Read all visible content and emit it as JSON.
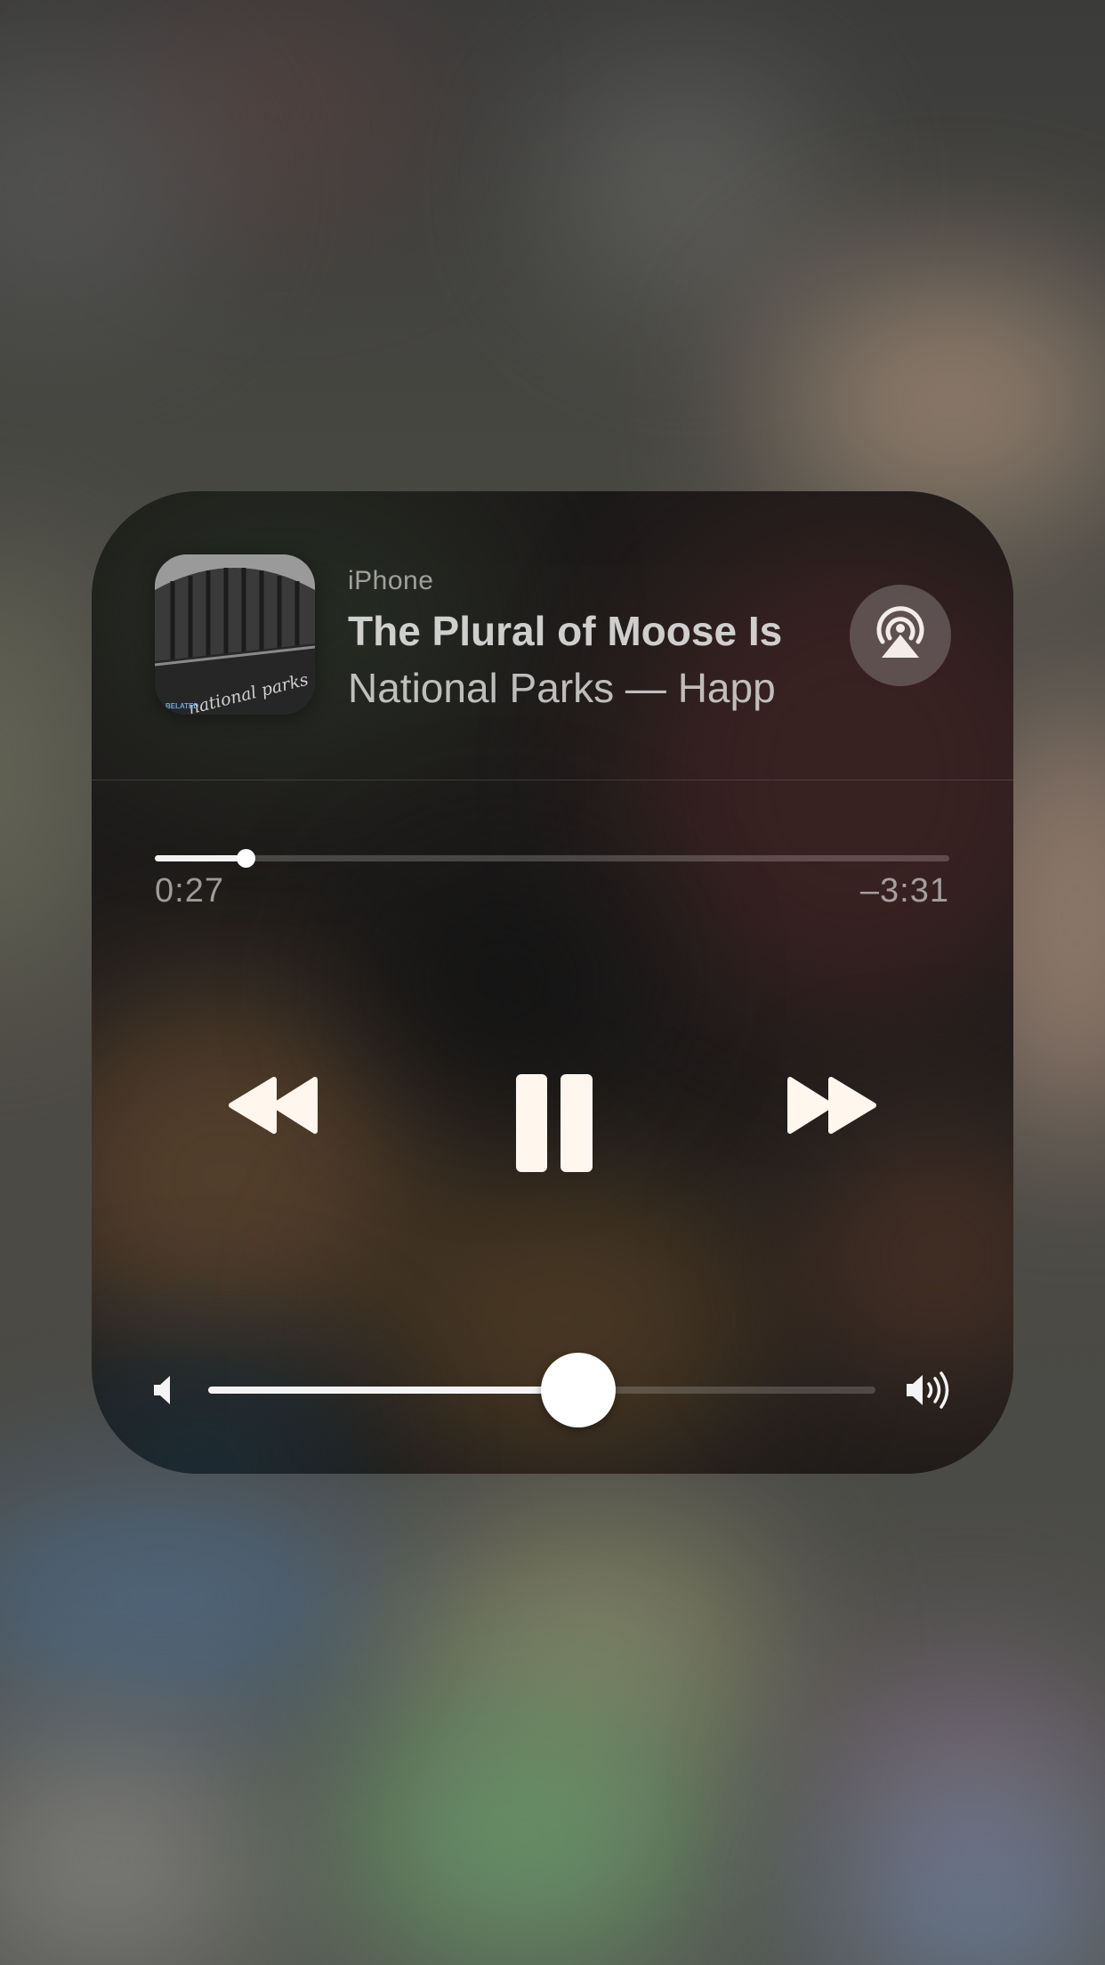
{
  "now_playing": {
    "source": "iPhone",
    "title": "The Plural of Moose Is",
    "subtitle": "National Parks — Happ",
    "artwork_text": "national parks",
    "artwork_tag": "BELATED",
    "airplay_icon": "airplay-icon"
  },
  "progress": {
    "elapsed": "0:27",
    "remaining": "–3:31",
    "fraction": 0.114
  },
  "controls": {
    "rewind_icon": "rewind-icon",
    "pause_icon": "pause-icon",
    "forward_icon": "fast-forward-icon"
  },
  "volume": {
    "level": 0.555,
    "low_icon": "speaker-low-icon",
    "high_icon": "speaker-high-icon"
  },
  "colors": {
    "text_primary": "#ebebeb",
    "control_fill": "#fff6ee",
    "knob": "#ffffff"
  }
}
